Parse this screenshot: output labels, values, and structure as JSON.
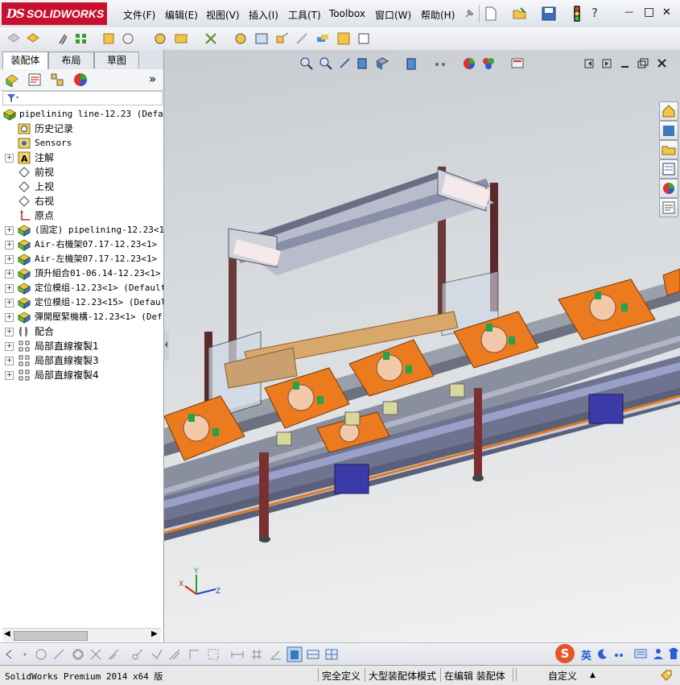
{
  "app": {
    "logo_ds": "DS",
    "logo_text": "SOLIDWORKS",
    "brand_color": "#c8102e"
  },
  "menu": [
    "文件(F)",
    "编辑(E)",
    "视图(V)",
    "插入(I)",
    "工具(T)",
    "Toolbox",
    "窗口(W)",
    "帮助(H)"
  ],
  "window_controls": {
    "minimize": "—",
    "restore": "□",
    "close": "✕",
    "help": "?"
  },
  "panel_tabs": [
    "装配体",
    "布局",
    "草图"
  ],
  "panel_expand": "»",
  "tree": [
    {
      "label": "pipelining line-12.23  (Defaul",
      "icon": "assembly-icon",
      "expand": false,
      "mono": true
    },
    {
      "label": "历史记录",
      "icon": "history-icon",
      "expand": false
    },
    {
      "label": "Sensors",
      "icon": "sensor-icon",
      "expand": false,
      "mono": true
    },
    {
      "label": "注解",
      "icon": "annotation-icon",
      "expand": true
    },
    {
      "label": "前视",
      "icon": "plane-icon",
      "expand": false
    },
    {
      "label": "上视",
      "icon": "plane-icon",
      "expand": false
    },
    {
      "label": "右视",
      "icon": "plane-icon",
      "expand": false
    },
    {
      "label": "原点",
      "icon": "origin-icon",
      "expand": false
    },
    {
      "label": "(固定) pipelining-12.23<1>",
      "icon": "subassembly-icon",
      "expand": true,
      "mono": true
    },
    {
      "label": "Air-右機架07.17-12.23<1>  (",
      "icon": "subassembly-icon",
      "expand": true,
      "mono": true
    },
    {
      "label": "Air-左機架07.17-12.23<1>  (",
      "icon": "subassembly-icon",
      "expand": true,
      "mono": true
    },
    {
      "label": "頂升組合01-06.14-12.23<1>",
      "icon": "subassembly-icon",
      "expand": true,
      "mono": true
    },
    {
      "label": "定位模组-12.23<1>  (Default",
      "icon": "subassembly-icon",
      "expand": true,
      "mono": true
    },
    {
      "label": "定位模组-12.23<15>  (Defaul",
      "icon": "subassembly-icon",
      "expand": true,
      "mono": true
    },
    {
      "label": "彈開壓緊機構-12.23<1>  (Def",
      "icon": "subassembly-icon",
      "expand": true,
      "mono": true
    },
    {
      "label": "配合",
      "icon": "mate-icon",
      "expand": true
    },
    {
      "label": "局部直線複製1",
      "icon": "pattern-icon",
      "expand": true
    },
    {
      "label": "局部直線複製3",
      "icon": "pattern-icon",
      "expand": true
    },
    {
      "label": "局部直線複製4",
      "icon": "pattern-icon",
      "expand": true
    }
  ],
  "triad": {
    "x": "X",
    "y": "Y",
    "z": "Z"
  },
  "ime": {
    "lang": "英",
    "logo": "S"
  },
  "status": {
    "product": "SolidWorks Premium 2014 x64 版",
    "definition": "完全定义",
    "mode": "大型装配体模式",
    "editing": "在编辑 装配体",
    "units": "自定义",
    "units_arrow": "▲"
  }
}
